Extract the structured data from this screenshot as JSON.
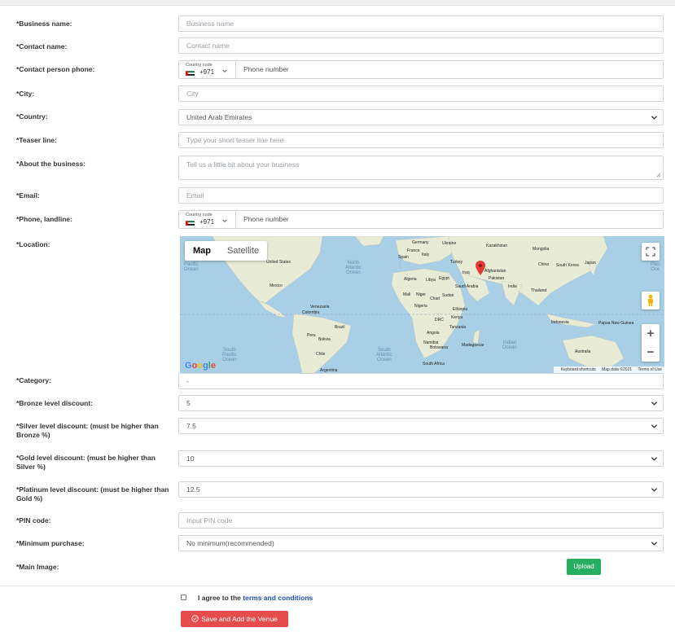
{
  "form": {
    "business_name": {
      "label": "*Business name:",
      "placeholder": "Business name"
    },
    "contact_name": {
      "label": "*Contact name:",
      "placeholder": "Contact name"
    },
    "contact_phone": {
      "label": "*Contact person phone:",
      "country_code_label": "Country code",
      "country_code": "+971",
      "placeholder": "Phone number"
    },
    "city": {
      "label": "*City:",
      "placeholder": "City"
    },
    "country": {
      "label": "*Country:",
      "value": "United Arab Emirates"
    },
    "teaser": {
      "label": "*Teaser line:",
      "placeholder": "Type your short teaser line here"
    },
    "about": {
      "label": "*About the business:",
      "placeholder": "Tell us a little bit about your business"
    },
    "email": {
      "label": "*Email:",
      "placeholder": "Email"
    },
    "landline": {
      "label": "*Phone, landline:",
      "country_code_label": "Country code",
      "country_code": "+971",
      "placeholder": "Phone number"
    },
    "location": {
      "label": "*Location:"
    },
    "category": {
      "label": "*Category:",
      "value": "-"
    },
    "bronze": {
      "label": "*Bronze level discount:",
      "value": "5"
    },
    "silver": {
      "label": "*Silver level discount: (must be higher than Bronze %)",
      "value": "7.5"
    },
    "gold": {
      "label": "*Gold level discount: (must be higher than Silver %)",
      "value": "10"
    },
    "platinum": {
      "label": "*Platinum level discount: (must be higher than Gold %)",
      "value": "12.5"
    },
    "pin": {
      "label": "*PIN code:",
      "placeholder": "Input PIN code"
    },
    "min_purchase": {
      "label": "*Minimum purchase:",
      "value": "No minimum(recommended)"
    },
    "main_image": {
      "label": "*Main Image:",
      "upload_label": "Upload"
    }
  },
  "map": {
    "tab_map": "Map",
    "tab_satellite": "Satellite",
    "zoom_in": "+",
    "zoom_out": "−",
    "google": "Google",
    "attribution": [
      "Keyboard shortcuts",
      "Map data ©2021",
      "Terms of Use"
    ],
    "oceans": [
      {
        "key": "north_pacific_w",
        "text": "North\nPacific\nOcean"
      },
      {
        "key": "north_atlantic",
        "text": "North\nAtlantic\nOcean"
      },
      {
        "key": "south_pacific",
        "text": "South\nPacific\nOcean"
      },
      {
        "key": "south_atlantic",
        "text": "South\nAtlantic\nOcean"
      },
      {
        "key": "indian",
        "text": "Indian\nOcean"
      },
      {
        "key": "north_pacific_e",
        "text": "Nor\nPaci\nOce"
      }
    ],
    "countries": [
      "United States",
      "Mexico",
      "Venezuela",
      "Colombia",
      "Peru",
      "Brazil",
      "Bolivia",
      "Chile",
      "Argentina",
      "Germany",
      "Ukraine",
      "France",
      "Spain",
      "Italy",
      "Turkey",
      "Iraq",
      "Kazakhstan",
      "Mongolia",
      "China",
      "South Korea",
      "Japan",
      "Afghanistan",
      "Pakistan",
      "India",
      "Thailand",
      "Indonesia",
      "Papua New Guinea",
      "Australia",
      "Algeria",
      "Libya",
      "Egypt",
      "Saudi Arabia",
      "Mali",
      "Niger",
      "Chad",
      "Sudan",
      "Nigeria",
      "Ethiopia",
      "DRC",
      "Kenya",
      "Tanzania",
      "Angola",
      "Namibia",
      "Botswana",
      "Madagascar",
      "South Africa"
    ]
  },
  "agree": {
    "prefix": "I agree to the",
    "link": "terms and conditions"
  },
  "submit_label": "Save and Add the Venue",
  "colors": {
    "primary": "#27ae60",
    "danger": "#e74c4c",
    "link": "#1a4eb0",
    "marker": "#e53935"
  }
}
